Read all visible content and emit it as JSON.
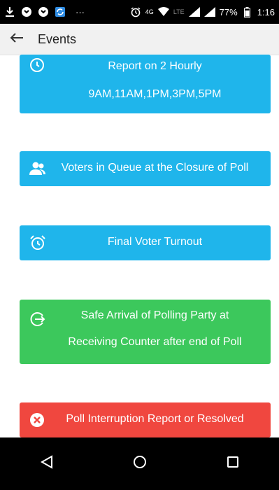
{
  "status_bar": {
    "network": "4G",
    "lte": "LTE",
    "battery": "77%",
    "time": "1:16",
    "more": "···"
  },
  "app_bar": {
    "title": "Events"
  },
  "cards": [
    {
      "line1": "Report on 2 Hourly",
      "line2": "9AM,11AM,1PM,3PM,5PM",
      "color": "#1fb5eb",
      "icon": "clock-icon"
    },
    {
      "line1": "Voters in Queue at the Closure of Poll",
      "color": "#1fb5eb",
      "icon": "people-icon"
    },
    {
      "line1": "Final Voter Turnout",
      "color": "#1fb5eb",
      "icon": "alarm-icon"
    },
    {
      "line1": "Safe Arrival of Polling Party at",
      "line2": "Receiving Counter after end of Poll",
      "color": "#3cc85c",
      "icon": "arrival-icon"
    },
    {
      "line1": "Poll Interruption Report or Resolved",
      "color": "#f0473f",
      "icon": "close-circle-icon"
    }
  ]
}
